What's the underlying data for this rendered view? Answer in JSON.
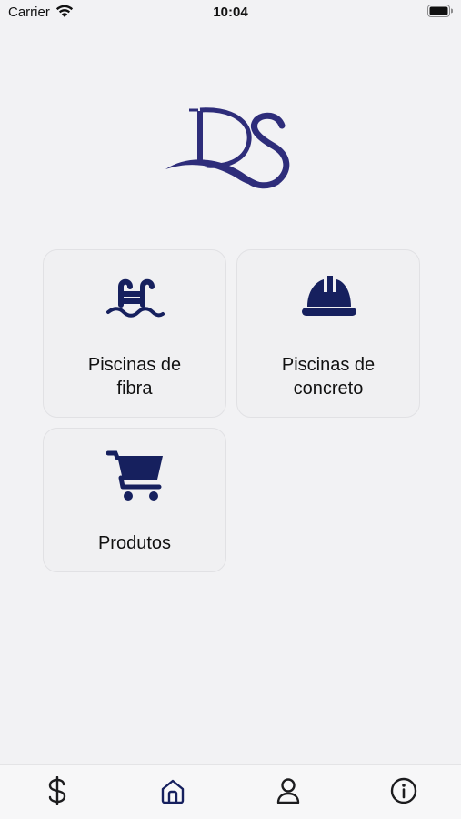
{
  "status_bar": {
    "carrier": "Carrier",
    "time": "10:04"
  },
  "logo": {
    "text": "DS",
    "color": "#2e2d7a"
  },
  "icon_color": "#16205e",
  "cards": [
    {
      "id": "piscinas-fibra",
      "label_line1": "Piscinas de",
      "label_line2": "fibra",
      "icon": "pool-ladder-icon"
    },
    {
      "id": "piscinas-concreto",
      "label_line1": "Piscinas de",
      "label_line2": "concreto",
      "icon": "hard-hat-icon"
    },
    {
      "id": "produtos",
      "label_line1": "Produtos",
      "icon": "shopping-cart-icon"
    }
  ],
  "tabbar": {
    "items": [
      {
        "icon": "dollar-icon",
        "active": false
      },
      {
        "icon": "home-icon",
        "active": true
      },
      {
        "icon": "user-icon",
        "active": false
      },
      {
        "icon": "info-icon",
        "active": false
      }
    ],
    "active_color": "#16205e",
    "inactive_color": "#1c1c1e"
  }
}
